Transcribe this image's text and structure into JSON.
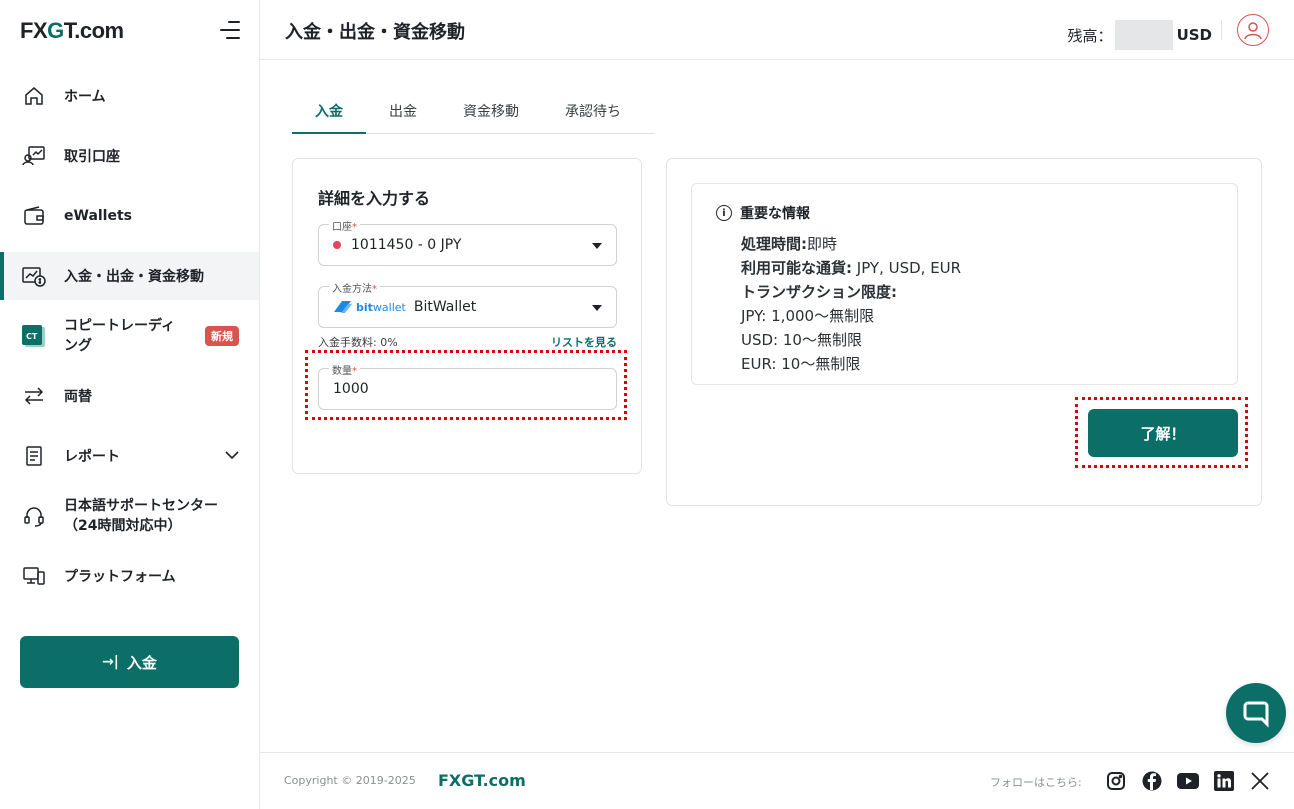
{
  "brand": {
    "logo_prefix": "FX",
    "logo_g": "G",
    "logo_suffix": "T.com"
  },
  "sidebar": {
    "items": [
      {
        "label": "ホーム",
        "icon": "home-icon"
      },
      {
        "label": "取引口座",
        "icon": "trading-account-icon"
      },
      {
        "label": "eWallets",
        "icon": "wallet-icon"
      },
      {
        "label": "入金・出金・資金移動",
        "icon": "transfer-money-icon",
        "active": true
      },
      {
        "label_line1": "コピートレーディ",
        "label_line2": "ング",
        "icon": "copy-trading-icon",
        "badge": "新規"
      },
      {
        "label": "両替",
        "icon": "exchange-icon"
      },
      {
        "label": "レポート",
        "icon": "report-icon"
      },
      {
        "label_line1": "日本語サポートセンター",
        "label_line2": "（24時間対応中）",
        "icon": "support-headset-icon"
      },
      {
        "label": "プラットフォーム",
        "icon": "platform-icon"
      }
    ],
    "deposit_button": "入金"
  },
  "header": {
    "title": "入金・出金・資金移動",
    "balance_label": "残高：",
    "balance_currency": "USD"
  },
  "tabs": [
    {
      "label": "入金",
      "active": true
    },
    {
      "label": "出金"
    },
    {
      "label": "資金移動"
    },
    {
      "label": "承認待ち"
    }
  ],
  "form": {
    "title": "詳細を入力する",
    "account": {
      "label": "口座",
      "value": "1011450 - 0 JPY"
    },
    "method": {
      "label": "入金方法",
      "logo_text_bold": "bit",
      "logo_text": "wallet",
      "value": "BitWallet"
    },
    "fee_text": "入金手数料: 0%",
    "list_link": "リストを見る",
    "amount": {
      "label": "数量",
      "value": "1000"
    },
    "required_mark": "*"
  },
  "info": {
    "title": "重要な情報",
    "processing_label": "処理時間:",
    "processing_value": "即時",
    "currencies_label": "利用可能な通貨:",
    "currencies_value": " JPY, USD, EUR",
    "limits_label": "トランザクション限度:",
    "limit_jpy": "JPY: 1,000〜無制限",
    "limit_usd": "USD: 10〜無制限",
    "limit_eur": "EUR: 10〜無制限",
    "ok_button": "了解！"
  },
  "footer": {
    "copyright": "Copyright © 2019-2025",
    "brand": "FXGT.com",
    "follow": "フォローはこちら:",
    "social": [
      "instagram-icon",
      "facebook-icon",
      "youtube-icon",
      "linkedin-icon",
      "x-icon"
    ]
  },
  "colors": {
    "accent": "#0b6f67",
    "badge": "#d9534f",
    "annotation": "#e00000"
  }
}
